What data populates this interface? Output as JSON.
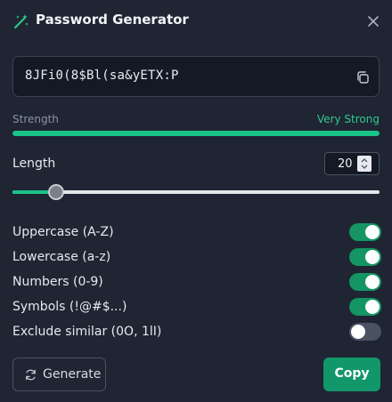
{
  "header": {
    "title": "Password Generator",
    "icon": "magic-wand-icon",
    "close_icon": "close-icon"
  },
  "password": {
    "value": "8JFi0(8$Bl(sa&yETX:P",
    "copy_icon": "copy-icon"
  },
  "strength": {
    "label": "Strength",
    "value": "Very Strong",
    "level_fraction": 1.0,
    "color": "#19c489"
  },
  "length": {
    "label": "Length",
    "value": "20",
    "slider_fraction": 0.12
  },
  "options": [
    {
      "label": "Uppercase (A-Z)",
      "enabled": true
    },
    {
      "label": "Lowercase (a-z)",
      "enabled": true
    },
    {
      "label": "Numbers (0-9)",
      "enabled": true
    },
    {
      "label": "Symbols (!@#$...)",
      "enabled": true
    },
    {
      "label": "Exclude similar (0O, 1lI)",
      "enabled": false
    }
  ],
  "actions": {
    "generate_label": "Generate",
    "generate_icon": "refresh-icon",
    "copy_label": "Copy"
  },
  "colors": {
    "accent": "#19c489",
    "background": "#1f2533",
    "toggle_on": "#149563",
    "toggle_off": "#495163"
  }
}
